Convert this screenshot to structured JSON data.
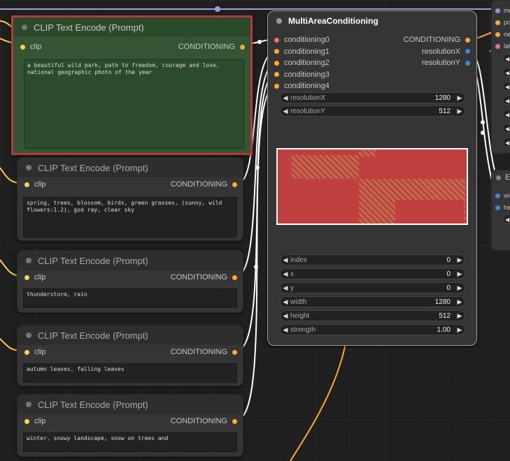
{
  "clip_nodes": [
    {
      "title": "CLIP Text Encode (Prompt)",
      "input_label": "clip",
      "output_label": "CONDITIONING",
      "text": "a beautiful wild park, path to freedom, courage and love, national geographic photo of the year"
    },
    {
      "title": "CLIP Text Encode (Prompt)",
      "input_label": "clip",
      "output_label": "CONDITIONING",
      "text": "spring, trees, blossom, birds, green grasses, (sunny, wild flowers:1.2), god ray, clear sky"
    },
    {
      "title": "CLIP Text Encode (Prompt)",
      "input_label": "clip",
      "output_label": "CONDITIONING",
      "text": "thunderstorm, rain"
    },
    {
      "title": "CLIP Text Encode (Prompt)",
      "input_label": "clip",
      "output_label": "CONDITIONING",
      "text": "autumn leaves, falling leaves"
    },
    {
      "title": "CLIP Text Encode (Prompt)",
      "input_label": "clip",
      "output_label": "CONDITIONING",
      "text": "winter, snowy landscape, snow on trees and"
    }
  ],
  "mac_node": {
    "title": "MultiAreaConditioning",
    "inputs": [
      "conditioning0",
      "conditioning1",
      "conditioning2",
      "conditioning3",
      "conditioning4"
    ],
    "outputs": [
      "CONDITIONING",
      "resolutionX",
      "resolutionY"
    ],
    "widgets_top": [
      {
        "label": "resolutionX",
        "value": "1280"
      },
      {
        "label": "resolutionY",
        "value": "512"
      }
    ],
    "widgets_bottom": [
      {
        "label": "index",
        "value": "0"
      },
      {
        "label": "x",
        "value": "0"
      },
      {
        "label": "y",
        "value": "0"
      },
      {
        "label": "width",
        "value": "1280"
      },
      {
        "label": "height",
        "value": "512"
      },
      {
        "label": "strength",
        "value": "1.00"
      }
    ]
  },
  "right_stub_top": {
    "labels": [
      "mo",
      "po",
      "ne",
      "lat"
    ]
  },
  "right_stub_bottom": {
    "title": "E",
    "labels": [
      "wi",
      "he"
    ]
  },
  "colors": {
    "clip": "#ffd24a",
    "conditioning": "#ffa931",
    "int": "#3c88d6",
    "latent": "#e46fb0",
    "preview_fill": "#c04040"
  }
}
